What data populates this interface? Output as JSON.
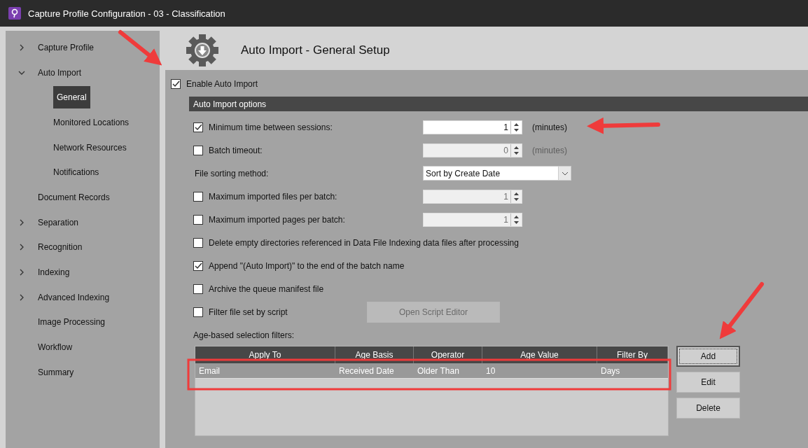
{
  "window": {
    "title": "Capture Profile Configuration - 03 - Classification"
  },
  "sidebar": {
    "items": [
      {
        "label": "Capture Profile",
        "expanded": false,
        "selected": false
      },
      {
        "label": "Auto Import",
        "expanded": true,
        "selected": false,
        "children": [
          {
            "label": "General",
            "selected": true
          },
          {
            "label": "Monitored Locations",
            "selected": false
          },
          {
            "label": "Network Resources",
            "selected": false
          },
          {
            "label": "Notifications",
            "selected": false
          }
        ]
      },
      {
        "label": "Document Records",
        "selected": false
      },
      {
        "label": "Separation",
        "expanded": false,
        "selected": false
      },
      {
        "label": "Recognition",
        "expanded": false,
        "selected": false
      },
      {
        "label": "Indexing",
        "expanded": false,
        "selected": false
      },
      {
        "label": "Advanced Indexing",
        "expanded": false,
        "selected": false
      },
      {
        "label": "Image Processing",
        "selected": false
      },
      {
        "label": "Workflow",
        "selected": false
      },
      {
        "label": "Summary",
        "selected": false
      }
    ]
  },
  "page": {
    "title": "Auto Import - General Setup"
  },
  "enable": {
    "label": "Enable Auto Import",
    "checked": true
  },
  "section": {
    "title": "Auto Import options"
  },
  "options": [
    {
      "kind": "checkbox",
      "label": "Minimum time between sessions:",
      "checked": true,
      "spin": {
        "value": "1",
        "unit": "(minutes)",
        "disabled": false
      }
    },
    {
      "kind": "checkbox",
      "label": "Batch timeout:",
      "checked": false,
      "spin": {
        "value": "0",
        "unit": "(minutes)",
        "disabled": true
      }
    },
    {
      "kind": "select",
      "label": "File sorting method:",
      "value": "Sort by Create Date"
    },
    {
      "kind": "checkbox",
      "label": "Maximum imported files per batch:",
      "checked": false,
      "spin": {
        "value": "1",
        "disabled": true
      }
    },
    {
      "kind": "checkbox",
      "label": "Maximum imported pages per batch:",
      "checked": false,
      "spin": {
        "value": "1",
        "disabled": true
      }
    },
    {
      "kind": "checkbox",
      "label": "Delete empty directories referenced in Data File Indexing data files after processing",
      "checked": false
    },
    {
      "kind": "checkbox",
      "label": "Append \"(Auto Import)\" to the end of the batch name",
      "checked": true
    },
    {
      "kind": "checkbox",
      "label": "Archive the queue manifest file",
      "checked": false
    },
    {
      "kind": "checkbox",
      "label": "Filter file set by script",
      "checked": false,
      "button": {
        "label": "Open Script Editor",
        "disabled": true
      }
    }
  ],
  "filters": {
    "label": "Age-based selection filters:",
    "columns": [
      "Apply To",
      "Age Basis",
      "Operator",
      "Age Value",
      "Filter By"
    ],
    "rows": [
      {
        "cells": [
          "Email",
          "Received Date",
          "Older Than",
          "10",
          "Days"
        ],
        "selected": true
      }
    ],
    "buttons": [
      {
        "label": "Add",
        "focused": true
      },
      {
        "label": "Edit",
        "focused": false
      },
      {
        "label": "Delete",
        "focused": false
      }
    ]
  }
}
